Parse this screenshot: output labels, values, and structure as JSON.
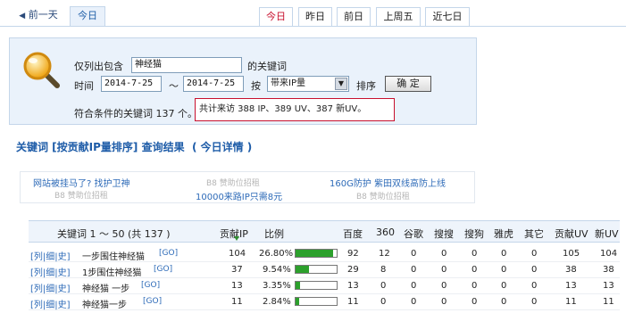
{
  "topbar": {
    "prev_day": "前一天",
    "today_left": "今日",
    "right_tabs": [
      "今日",
      "昨日",
      "前日",
      "上周五",
      "近七日"
    ],
    "active_color": "#c8102e"
  },
  "filter": {
    "only_list_label": "仅列出包含",
    "keyword_value": "神经猫",
    "keyword_suffix": "的关键词",
    "time_label": "时间",
    "date_from": "2014-7-25",
    "tilde": "～",
    "date_to": "2014-7-25",
    "by_label": "按",
    "sort_field": "带来IP量",
    "sort_label": "排序",
    "confirm_button": "确 定",
    "match_text": "符合条件的关键词 137 个。",
    "summary_text": "共计来访 388 IP、389 UV、387 新UV。"
  },
  "result_title": "关键词 [按贡献IP量排序] 查询结果  ( 今日详情 )",
  "ads": {
    "a1": "网站被挂马了? 找护卫神",
    "a2": "B8 赞助位招租",
    "a3": "160G防护 紫田双线高防上线",
    "a4": "B8 赞助位招租",
    "a5": "10000来路IP只需8元",
    "a6": "B8 赞助位招租"
  },
  "table": {
    "headers": {
      "keyword": "关键词 1 ～ 50 (共 137 )",
      "ip": "贡献IP",
      "ratio": "比例",
      "baidu": "百度",
      "s360": "360",
      "google": "谷歌",
      "sogou_search": "搜搜",
      "sogou": "搜狗",
      "yahoo": "雅虎",
      "other": "其它",
      "uv": "贡献UV",
      "newuv": "新UV"
    },
    "rows": [
      {
        "links": "[列|细|史]",
        "keyword": "一步围住神经猫",
        "go": "[GO]",
        "ip": "104",
        "ratio": "26.80%",
        "ratio_value": 0.268,
        "baidu": "92",
        "s360": "12",
        "google": "0",
        "sogou_search": "0",
        "sogou": "0",
        "yahoo": "0",
        "other": "0",
        "uv": "105",
        "newuv": "104"
      },
      {
        "links": "[列|细|史]",
        "keyword": "1步围住神经猫",
        "go": "[GO]",
        "ip": "37",
        "ratio": "9.54%",
        "ratio_value": 0.0954,
        "baidu": "29",
        "s360": "8",
        "google": "0",
        "sogou_search": "0",
        "sogou": "0",
        "yahoo": "0",
        "other": "0",
        "uv": "38",
        "newuv": "38"
      },
      {
        "links": "[列|细|史]",
        "keyword": "神经猫 一步",
        "go": "[GO]",
        "ip": "13",
        "ratio": "3.35%",
        "ratio_value": 0.0335,
        "baidu": "13",
        "s360": "0",
        "google": "0",
        "sogou_search": "0",
        "sogou": "0",
        "yahoo": "0",
        "other": "0",
        "uv": "13",
        "newuv": "13"
      },
      {
        "links": "[列|细|史]",
        "keyword": "神经猫一步",
        "go": "[GO]",
        "ip": "11",
        "ratio": "2.84%",
        "ratio_value": 0.0284,
        "baidu": "11",
        "s360": "0",
        "google": "0",
        "sogou_search": "0",
        "sogou": "0",
        "yahoo": "0",
        "other": "0",
        "uv": "11",
        "newuv": "11"
      }
    ]
  }
}
